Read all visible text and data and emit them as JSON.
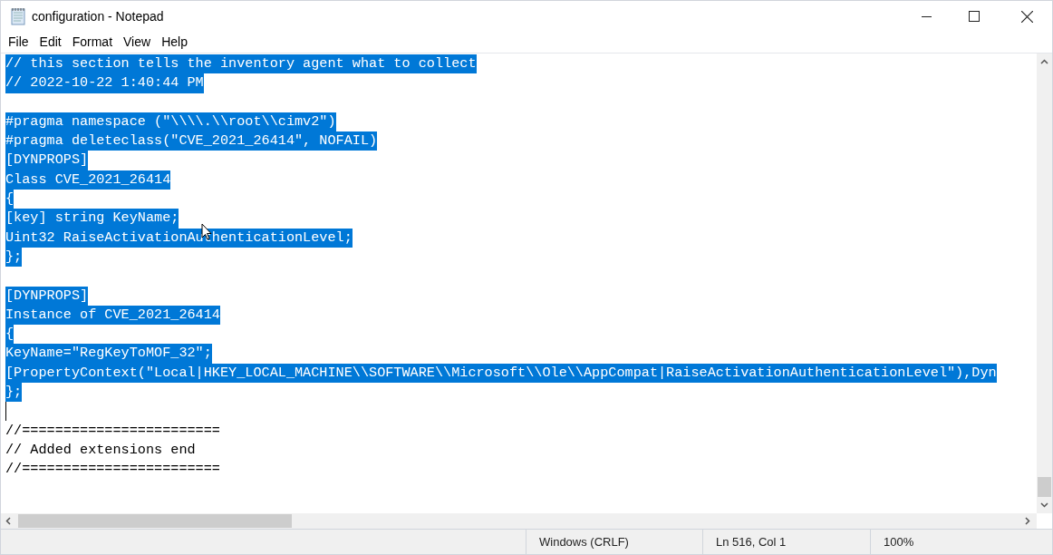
{
  "window": {
    "title": "configuration - Notepad"
  },
  "menu": [
    "File",
    "Edit",
    "Format",
    "View",
    "Help"
  ],
  "lines": [
    {
      "kind": "text",
      "text": "// this section tells the inventory agent what to collect",
      "selected": true
    },
    {
      "kind": "text",
      "text": "// 2022-10-22 1:40:44 PM",
      "selected": true
    },
    {
      "kind": "blank"
    },
    {
      "kind": "text",
      "text": "#pragma namespace (\"\\\\\\\\.\\\\root\\\\cimv2\")",
      "selected": true
    },
    {
      "kind": "text",
      "text": "#pragma deleteclass(\"CVE_2021_26414\", NOFAIL)",
      "selected": true
    },
    {
      "kind": "text",
      "text": "[DYNPROPS]",
      "selected": true
    },
    {
      "kind": "text",
      "text": "Class CVE_2021_26414",
      "selected": true
    },
    {
      "kind": "text",
      "text": "{",
      "selected": true
    },
    {
      "kind": "text",
      "text": "[key] string KeyName;",
      "selected": true
    },
    {
      "kind": "text",
      "text": "Uint32 RaiseActivationAuthenticationLevel;",
      "selected": true
    },
    {
      "kind": "text",
      "text": "};",
      "selected": true
    },
    {
      "kind": "blank"
    },
    {
      "kind": "text",
      "text": "[DYNPROPS]",
      "selected": true
    },
    {
      "kind": "text",
      "text": "Instance of CVE_2021_26414",
      "selected": true
    },
    {
      "kind": "text",
      "text": "{",
      "selected": true
    },
    {
      "kind": "text",
      "text": "KeyName=\"RegKeyToMOF_32\";",
      "selected": true
    },
    {
      "kind": "text",
      "text": "[PropertyContext(\"Local|HKEY_LOCAL_MACHINE\\\\SOFTWARE\\\\Microsoft\\\\Ole\\\\AppCompat|RaiseActivationAuthenticationLevel\"),Dyn",
      "selected": true
    },
    {
      "kind": "text",
      "text": "};",
      "selected": true
    },
    {
      "kind": "caret"
    },
    {
      "kind": "text",
      "text": "//========================",
      "selected": false
    },
    {
      "kind": "text",
      "text": "// Added extensions end",
      "selected": false
    },
    {
      "kind": "text",
      "text": "//========================",
      "selected": false
    }
  ],
  "status_bar": [
    "Windows (CRLF)",
    "Ln 516, Col 1",
    "100%"
  ]
}
